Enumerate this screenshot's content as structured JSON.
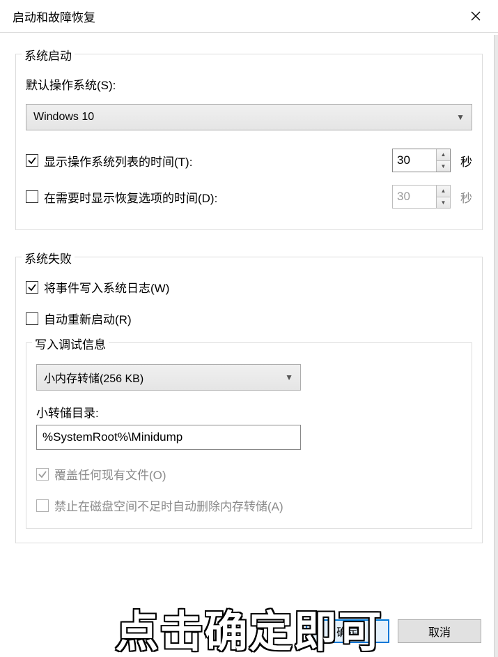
{
  "window": {
    "title": "启动和故障恢复"
  },
  "system_startup": {
    "legend": "系统启动",
    "default_os_label": "默认操作系统(S):",
    "default_os_value": "Windows 10",
    "os_list_time": {
      "checked": true,
      "label": "显示操作系统列表的时间(T):",
      "value": "30",
      "unit": "秒"
    },
    "recovery_time": {
      "checked": false,
      "label": "在需要时显示恢复选项的时间(D):",
      "value": "30",
      "unit": "秒"
    }
  },
  "system_failure": {
    "legend": "系统失败",
    "write_event": {
      "checked": true,
      "label": "将事件写入系统日志(W)"
    },
    "auto_restart": {
      "checked": false,
      "label": "自动重新启动(R)"
    },
    "debug_info": {
      "legend": "写入调试信息",
      "dump_type_value": "小内存转储(256 KB)",
      "dump_dir_label": "小转储目录:",
      "dump_dir_value": "%SystemRoot%\\Minidump",
      "overwrite": {
        "checked": true,
        "disabled": true,
        "label": "覆盖任何现有文件(O)"
      },
      "no_auto_delete": {
        "checked": false,
        "disabled": true,
        "label": "禁止在磁盘空间不足时自动删除内存转储(A)"
      }
    }
  },
  "buttons": {
    "ok": "确定",
    "cancel": "取消"
  },
  "overlay": "点击确定即可"
}
